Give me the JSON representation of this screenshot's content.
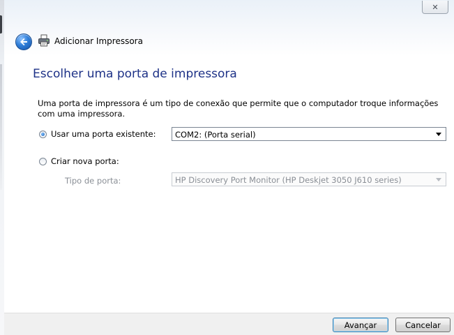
{
  "window": {
    "close_glyph": "✕",
    "title": "Adicionar Impressora"
  },
  "page": {
    "heading": "Escolher uma porta de impressora",
    "description": "Uma porta de impressora é um tipo de conexão que permite que o computador troque informações com uma impressora."
  },
  "options": {
    "existing": {
      "label": "Usar uma porta existente:",
      "selected": true,
      "value": "COM2: (Porta serial)"
    },
    "new": {
      "label": "Criar nova porta:",
      "selected": false,
      "type_label": "Tipo de porta:",
      "type_value": "HP Discovery Port Monitor (HP Deskjet 3050 J610 series)"
    }
  },
  "footer": {
    "next_label": "Avançar",
    "cancel_label": "Cancelar"
  },
  "colors": {
    "heading": "#1e3287",
    "accent": "#2f7ed8"
  },
  "icons": {
    "back": "back-arrow-icon",
    "printer": "printer-icon",
    "close": "close-icon"
  }
}
